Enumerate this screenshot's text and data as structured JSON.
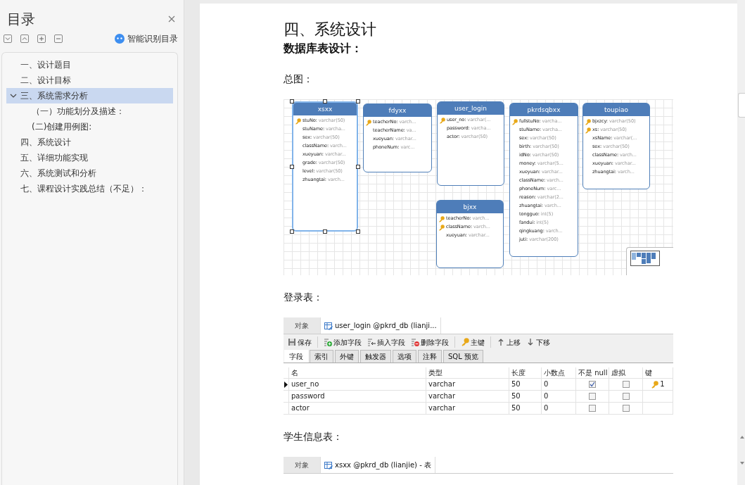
{
  "sidebar": {
    "title": "目录",
    "smart_toc": "智能识别目录",
    "items": [
      {
        "label": "一、设计题目",
        "selected": false
      },
      {
        "label": "二、设计目标",
        "selected": false
      },
      {
        "label": "三、系统需求分析",
        "selected": true,
        "expanded": true,
        "children": [
          {
            "label": "（一）功能划分及描述：",
            "selected": false
          },
          {
            "label": "(二)创建用例图:",
            "selected": false
          }
        ]
      },
      {
        "label": "四、系统设计",
        "selected": false
      },
      {
        "label": "五、详细功能实现",
        "selected": false
      },
      {
        "label": "六、系统测试和分析",
        "selected": false
      },
      {
        "label": "七、课程设计实践总结（不足）：",
        "selected": false
      }
    ]
  },
  "document": {
    "heading": "四、系统设计",
    "subheading": "数据库表设计：",
    "blocks": [
      {
        "kind": "caption",
        "text": "总图："
      },
      {
        "kind": "er_diagram",
        "tables": [
          {
            "name": "xsxx",
            "selected": true,
            "fields": [
              {
                "name": "stuNo:",
                "type": "varchar(50)",
                "key": true
              },
              {
                "name": "stuName:",
                "type": "varcha...",
                "key": false
              },
              {
                "name": "sex:",
                "type": "varchar(50)",
                "key": false
              },
              {
                "name": "className:",
                "type": "varch...",
                "key": false
              },
              {
                "name": "xueyuan:",
                "type": "varchar...",
                "key": false
              },
              {
                "name": "grade:",
                "type": "varchar(50)",
                "key": false
              },
              {
                "name": "level:",
                "type": "varchar(50)",
                "key": false
              },
              {
                "name": "zhuangtai:",
                "type": "varch...",
                "key": false
              }
            ]
          },
          {
            "name": "fdyxx",
            "selected": false,
            "fields": [
              {
                "name": "teacherNo:",
                "type": "varch...",
                "key": true
              },
              {
                "name": "teacherName:",
                "type": "va...",
                "key": false
              },
              {
                "name": "xueyuan:",
                "type": "varchar...",
                "key": false
              },
              {
                "name": "phoneNum:",
                "type": "varc...",
                "key": false
              }
            ]
          },
          {
            "name": "user_login",
            "selected": false,
            "fields": [
              {
                "name": "user_no:",
                "type": "varchar(...",
                "key": true
              },
              {
                "name": "password:",
                "type": "varcha...",
                "key": false
              },
              {
                "name": "actor:",
                "type": "varchar(50)",
                "key": false
              }
            ]
          },
          {
            "name": "bjxx",
            "selected": false,
            "fields": [
              {
                "name": "teacherNo:",
                "type": "varch...",
                "key": true
              },
              {
                "name": "className:",
                "type": "varch...",
                "key": true
              },
              {
                "name": "xueyuan:",
                "type": "varchar...",
                "key": false
              }
            ]
          },
          {
            "name": "pkrdsqbxx",
            "selected": false,
            "fields": [
              {
                "name": "fullstuNo:",
                "type": "varcha...",
                "key": true
              },
              {
                "name": "stuName:",
                "type": "varcha...",
                "key": false
              },
              {
                "name": "sex:",
                "type": "varchar(50)",
                "key": false
              },
              {
                "name": "birth:",
                "type": "varchar(50)",
                "key": false
              },
              {
                "name": "idNo:",
                "type": "varchar(50)",
                "key": false
              },
              {
                "name": "money:",
                "type": "varchar(5...",
                "key": false
              },
              {
                "name": "xueyuan:",
                "type": "varchar...",
                "key": false
              },
              {
                "name": "className:",
                "type": "varch...",
                "key": false
              },
              {
                "name": "phoneNum:",
                "type": "varc...",
                "key": false
              },
              {
                "name": "reason:",
                "type": "varchar(2...",
                "key": false
              },
              {
                "name": "zhuangtai:",
                "type": "varch...",
                "key": false
              },
              {
                "name": "tongguo:",
                "type": "int(5)",
                "key": false
              },
              {
                "name": "fandui:",
                "type": "int(5)",
                "key": false
              },
              {
                "name": "qingkuang:",
                "type": "varch...",
                "key": false
              },
              {
                "name": "juti:",
                "type": "varchar(200)",
                "key": false
              }
            ]
          },
          {
            "name": "toupiao",
            "selected": false,
            "fields": [
              {
                "name": "bjxzcy:",
                "type": "varchar(50)",
                "key": true
              },
              {
                "name": "xs:",
                "type": "varchar(50)",
                "key": true
              },
              {
                "name": "xsName:",
                "type": "varchar(...",
                "key": false
              },
              {
                "name": "sex:",
                "type": "varchar(50)",
                "key": false
              },
              {
                "name": "className:",
                "type": "varch...",
                "key": false
              },
              {
                "name": "xueyuan:",
                "type": "varchar...",
                "key": false
              },
              {
                "name": "zhuangtai:",
                "type": "varch...",
                "key": false
              }
            ]
          }
        ]
      },
      {
        "kind": "caption",
        "text": "登录表："
      },
      {
        "kind": "designer",
        "tabs": [
          {
            "kind": "objects",
            "label": "对象",
            "selected": false
          },
          {
            "kind": "table",
            "label": "user_login @pkrd_db (lianji...",
            "selected": true
          }
        ],
        "toolbar": [
          {
            "kind": "save",
            "label": "保存"
          },
          {
            "kind": "add",
            "label": "添加字段"
          },
          {
            "kind": "insert",
            "label": "插入字段"
          },
          {
            "kind": "delete",
            "label": "删除字段"
          },
          {
            "kind": "key",
            "label": "主键"
          },
          {
            "kind": "up",
            "label": "上移"
          },
          {
            "kind": "down",
            "label": "下移"
          }
        ],
        "subtabs": [
          {
            "label": "字段",
            "selected": true
          },
          {
            "label": "索引",
            "selected": false
          },
          {
            "label": "外键",
            "selected": false
          },
          {
            "label": "触发器",
            "selected": false
          },
          {
            "label": "选项",
            "selected": false
          },
          {
            "label": "注释",
            "selected": false
          },
          {
            "label": "SQL 预览",
            "selected": false
          }
        ],
        "columns": [
          "名",
          "类型",
          "长度",
          "小数点",
          "不是 null",
          "虚拟",
          "键"
        ],
        "rows": [
          {
            "current": true,
            "name": "user_no",
            "type": "varchar",
            "length": "50",
            "decimals": "0",
            "not_null": true,
            "virtual": false,
            "key": "1"
          },
          {
            "current": false,
            "name": "password",
            "type": "varchar",
            "length": "50",
            "decimals": "0",
            "not_null": false,
            "virtual": false
          },
          {
            "current": false,
            "name": "actor",
            "type": "varchar",
            "length": "50",
            "decimals": "0",
            "not_null": false,
            "virtual": false
          }
        ]
      },
      {
        "kind": "caption",
        "text": "学生信息表："
      },
      {
        "kind": "designer",
        "tabs": [
          {
            "kind": "objects",
            "label": "对象",
            "selected": false
          },
          {
            "kind": "table",
            "label": "xsxx @pkrd_db (lianjie) - 表",
            "selected": true
          }
        ]
      }
    ]
  }
}
